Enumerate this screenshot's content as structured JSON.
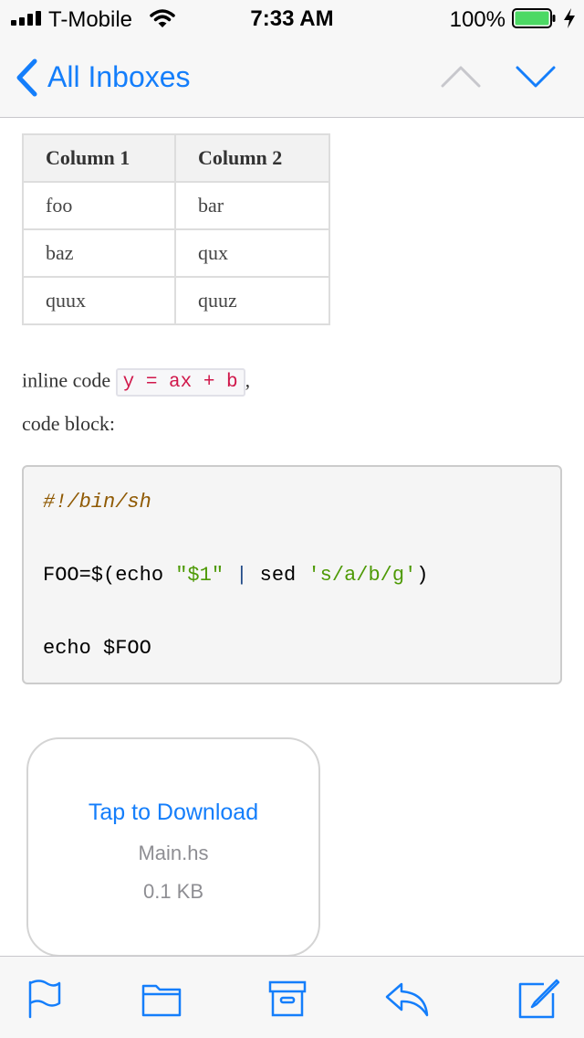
{
  "status": {
    "carrier": "T-Mobile",
    "time": "7:33 AM",
    "battery_percent": "100%"
  },
  "nav": {
    "back_label": "All Inboxes"
  },
  "message": {
    "table": {
      "headers": [
        "Column 1",
        "Column 2"
      ],
      "rows": [
        [
          "foo",
          "bar"
        ],
        [
          "baz",
          "qux"
        ],
        [
          "quux",
          "quuz"
        ]
      ]
    },
    "inline_prefix": "inline code",
    "inline_code": "y = ax + b",
    "inline_suffix": ",",
    "code_block_label": "code block:",
    "code": {
      "line1": "#!/bin/sh",
      "line2_a": "FOO=$(echo ",
      "line2_str1": "\"$1\"",
      "line2_pipe": "|",
      "line2_b": "sed ",
      "line2_str2": "'s/a/b/g'",
      "line2_c": ")",
      "line3": "echo $FOO"
    }
  },
  "attachment": {
    "action": "Tap to Download",
    "filename": "Main.hs",
    "size": "0.1 KB"
  },
  "colors": {
    "accent": "#147efb",
    "battery": "#4cd964",
    "inline_code": "#d0174a"
  },
  "icons": [
    "signal-icon",
    "wifi-icon",
    "battery-icon",
    "charging-icon",
    "back-chevron-icon",
    "previous-message-icon",
    "next-message-icon",
    "flag-icon",
    "folder-icon",
    "archive-icon",
    "reply-icon",
    "compose-icon"
  ]
}
